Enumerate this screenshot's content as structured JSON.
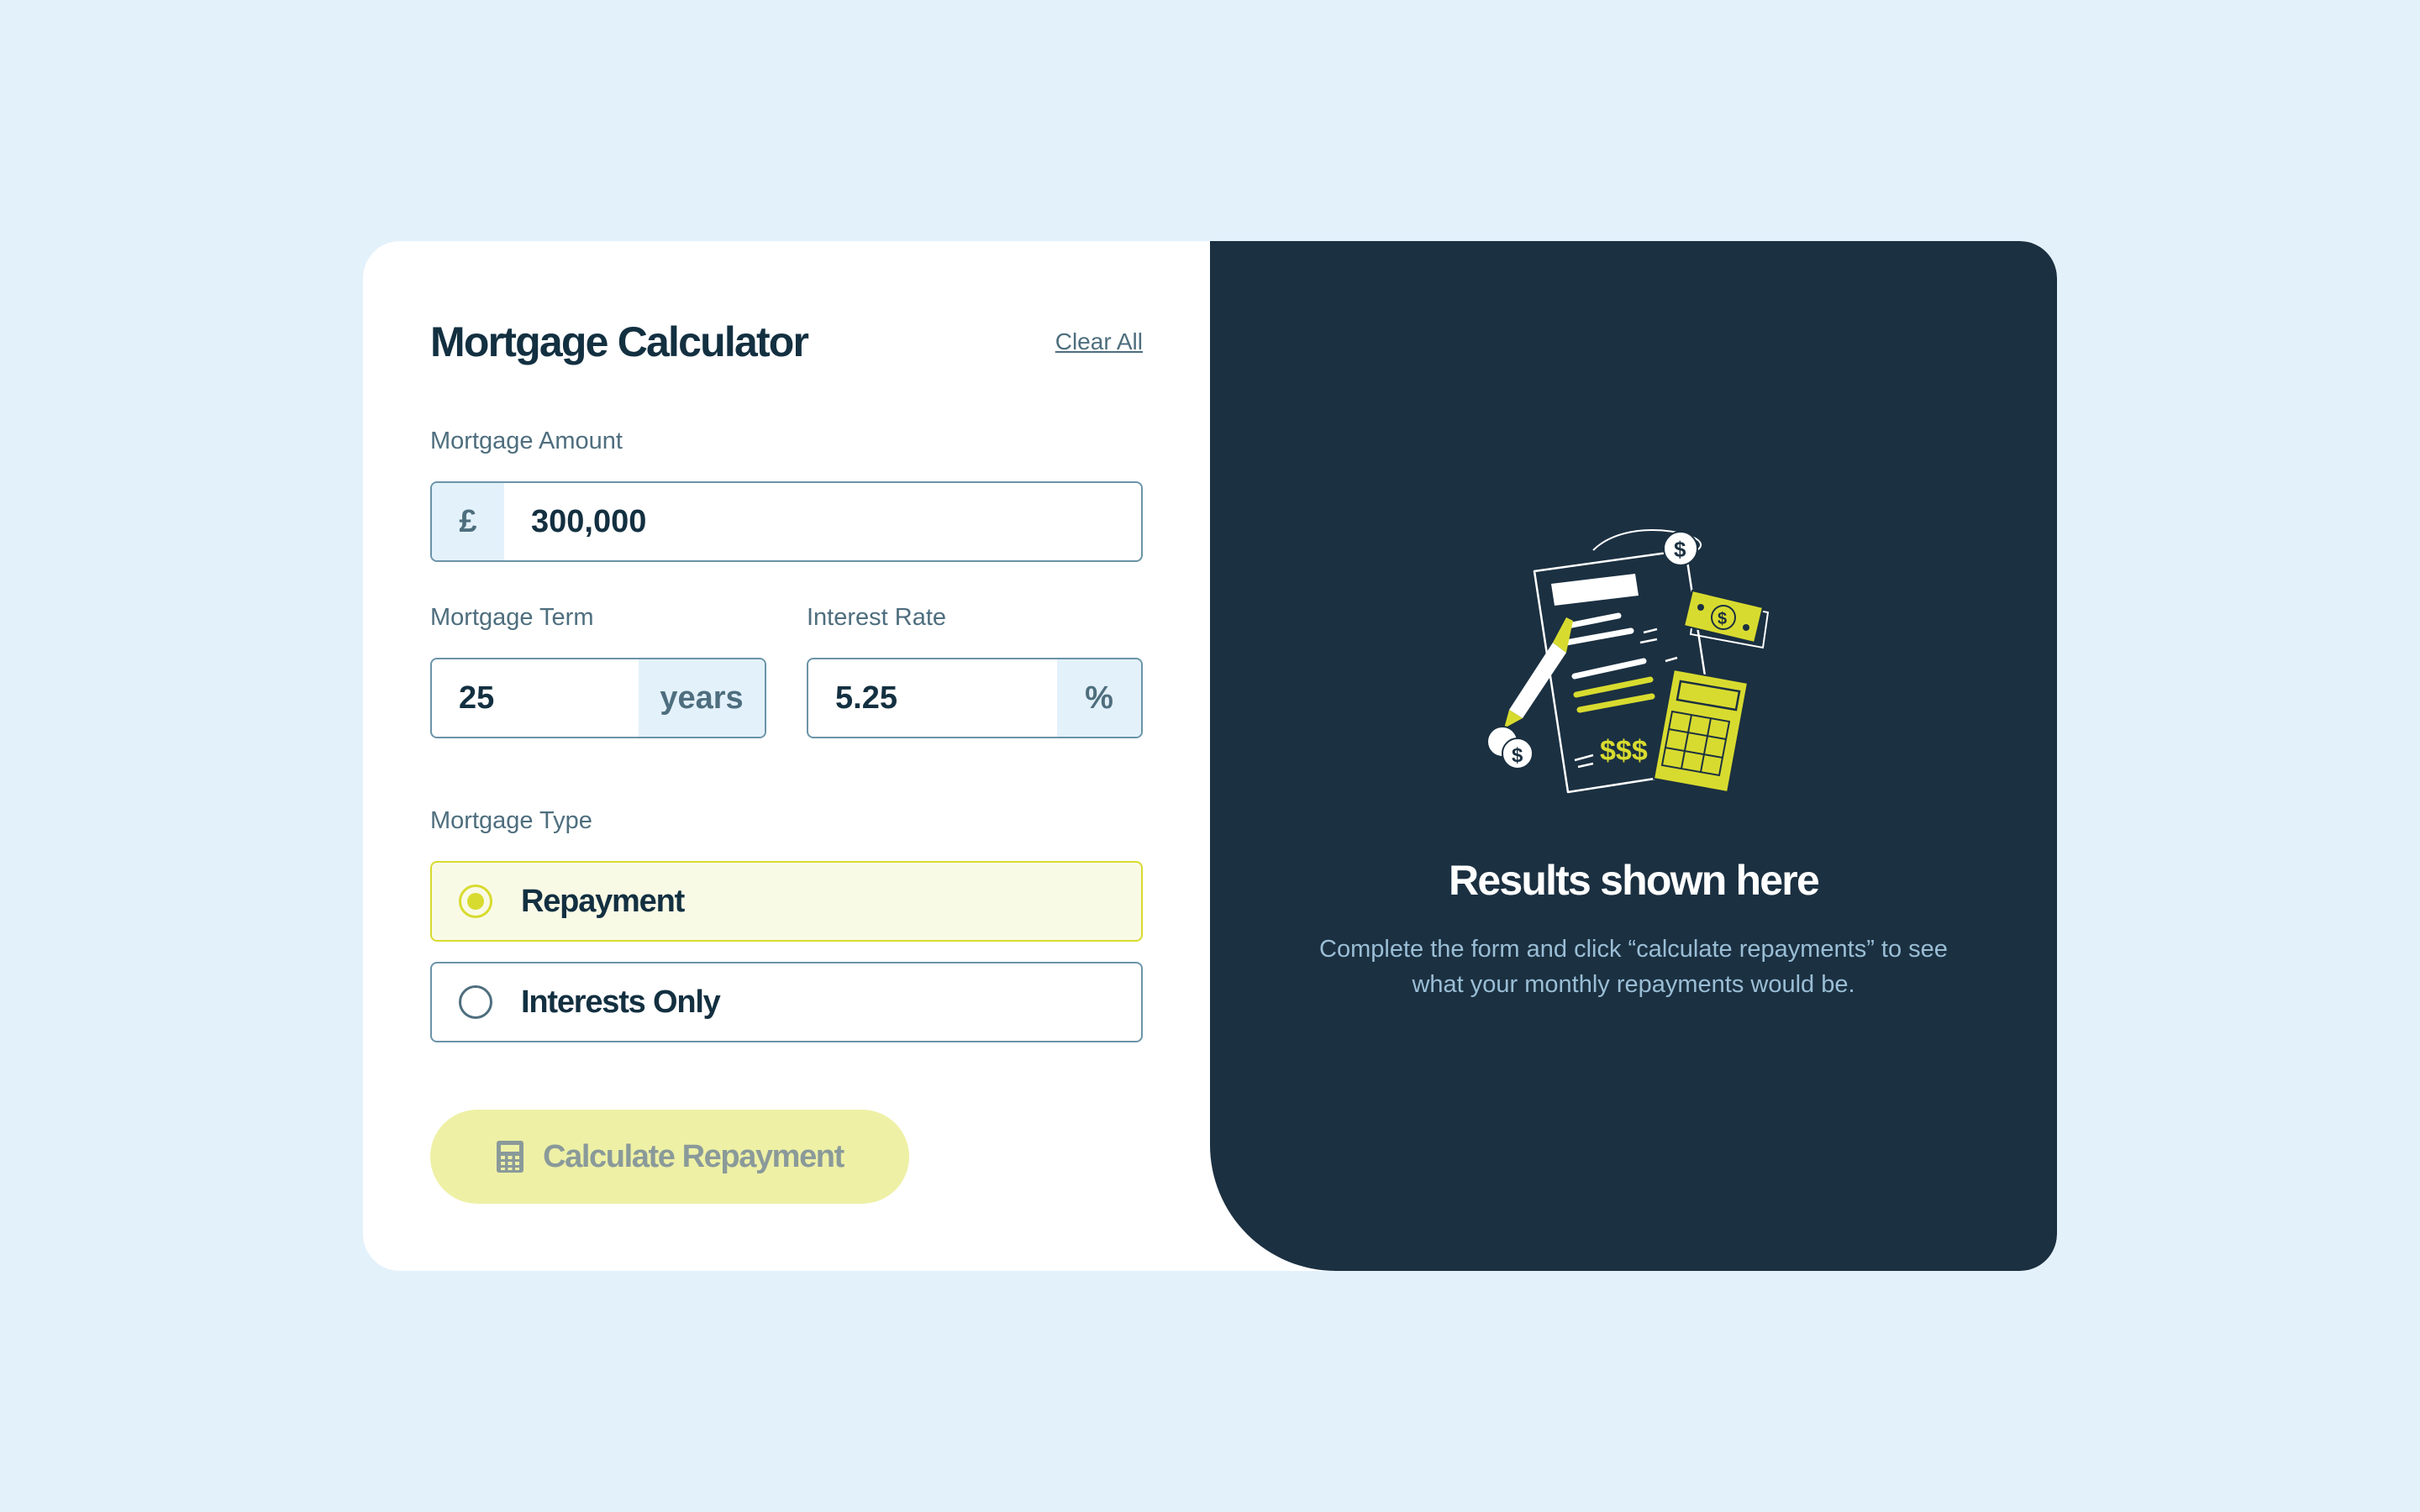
{
  "header": {
    "title": "Mortgage Calculator",
    "clear_label": "Clear All"
  },
  "form": {
    "amount": {
      "label": "Mortgage Amount",
      "prefix": "£",
      "value": "300,000"
    },
    "term": {
      "label": "Mortgage Term",
      "value": "25",
      "suffix": "years"
    },
    "rate": {
      "label": "Interest Rate",
      "value": "5.25",
      "suffix": "%"
    },
    "type": {
      "label": "Mortgage Type",
      "options": [
        {
          "label": "Repayment",
          "selected": true
        },
        {
          "label": "Interests Only",
          "selected": false
        }
      ]
    },
    "submit_label": "Calculate Repayment"
  },
  "results": {
    "title": "Results shown here",
    "description": "Complete the form and click “calculate repayments” to see what your monthly repayments would be."
  },
  "colors": {
    "page_background": "#e3f1fb",
    "dark_panel": "#1b3041",
    "accent_lime": "#d8db2f",
    "text_dark": "#133041",
    "text_muted": "#4e6e7e"
  },
  "icons": {
    "button_icon": "calculator-icon",
    "illustration": "empty-results-illustration"
  }
}
